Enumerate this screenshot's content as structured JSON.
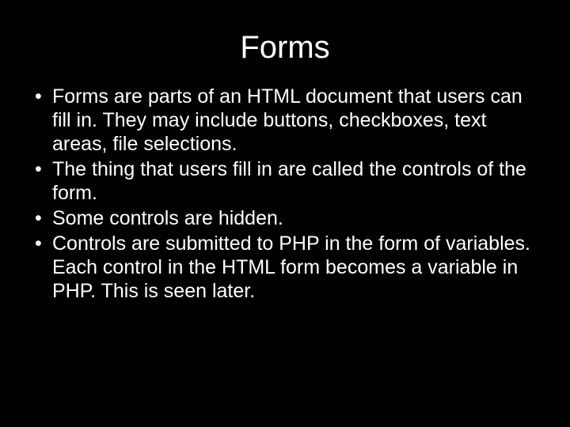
{
  "slide": {
    "title": "Forms",
    "bullets": [
      "Forms are parts of an HTML document that users can fill in. They may include buttons, checkboxes, text areas, file selections.",
      "The thing that users fill in are called the controls of the form.",
      "Some controls are hidden.",
      "Controls are submitted to PHP in the form of variables. Each control in the HTML form becomes a variable in PHP. This is seen later."
    ]
  }
}
